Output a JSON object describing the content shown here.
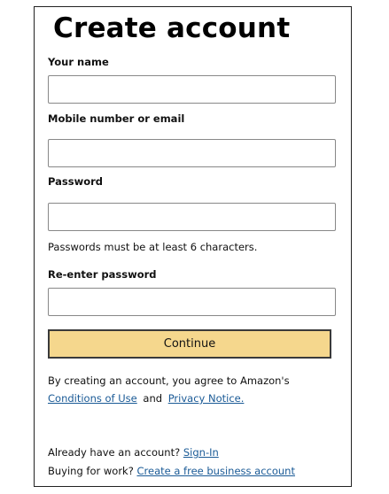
{
  "page": {
    "title": "Create account"
  },
  "form": {
    "name_label": "Your name",
    "name_value": "",
    "contact_label": "Mobile number or email",
    "contact_value": "",
    "password_label": "Password",
    "password_value": "",
    "password_hint": "Passwords must be at least 6 characters.",
    "reenter_label": "Re-enter password",
    "reenter_value": "",
    "continue_label": "Continue"
  },
  "legal": {
    "line1": "By creating an account, you agree to Amazon's",
    "conditions_link": "Conditions of Use",
    "and_text": "and",
    "privacy_link": "Privacy Notice."
  },
  "footer": {
    "have_account_text": "Already have an account?",
    "sign_in_link": "Sign-In",
    "buying_for_work_text": "Buying for work?",
    "business_link": "Create a free business account"
  },
  "colors": {
    "button_bg": "#f5d78d",
    "link": "#1a5a96"
  }
}
